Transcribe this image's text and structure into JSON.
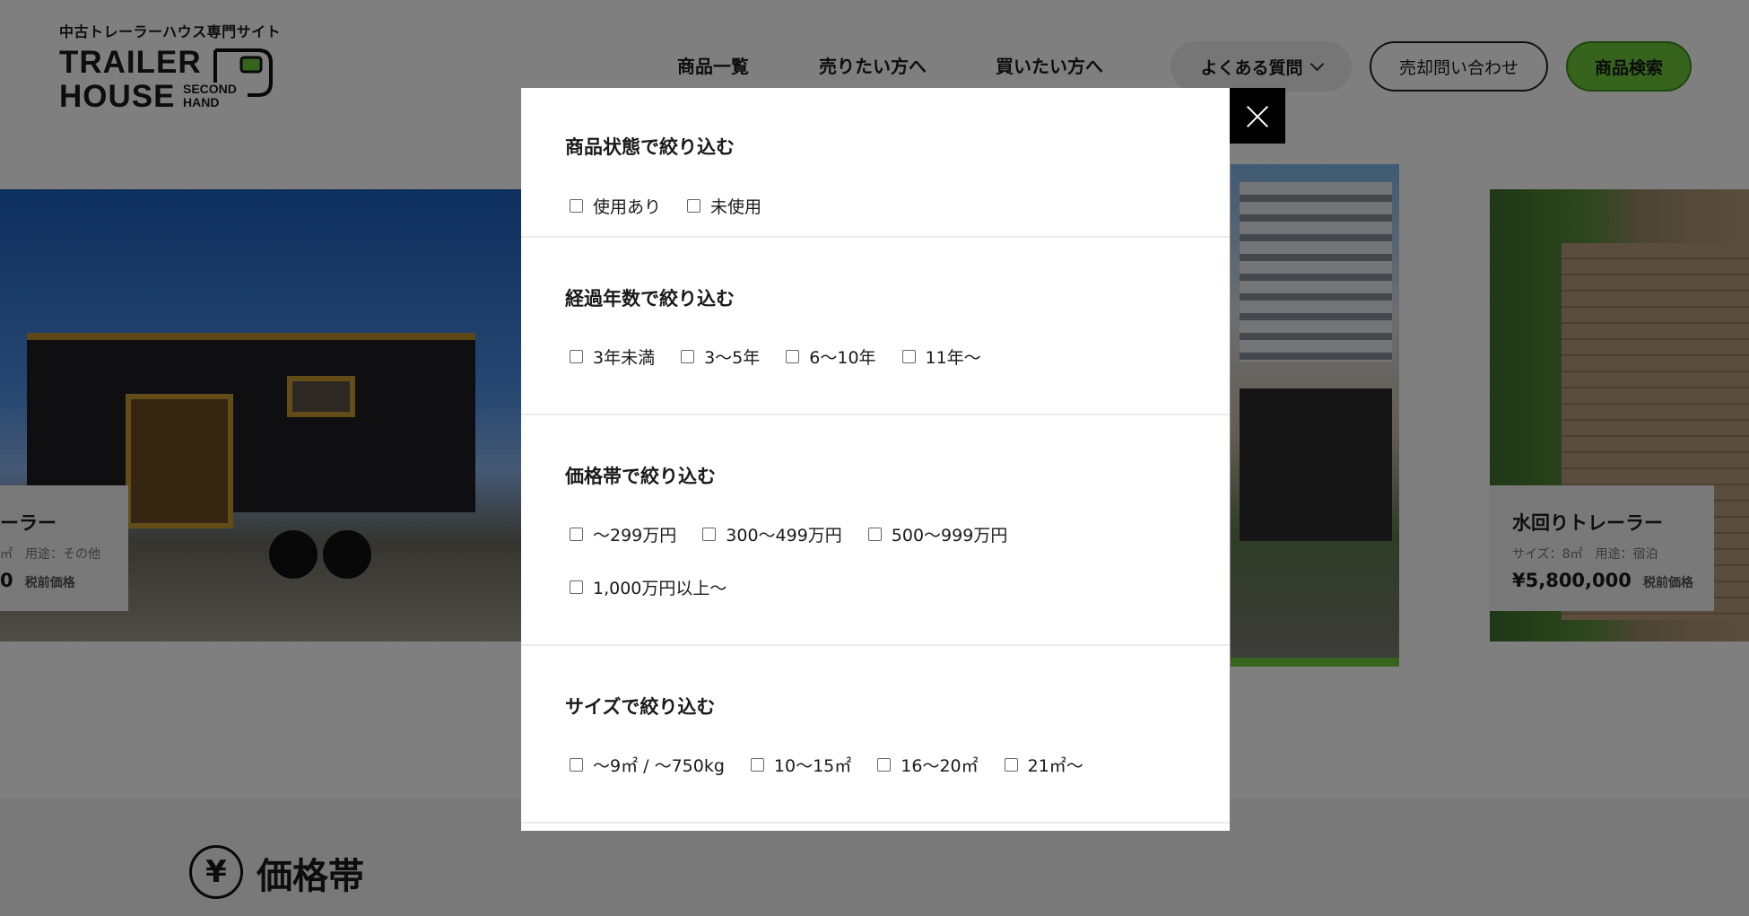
{
  "header": {
    "logo_tagline": "中古トレーラーハウス専門サイト",
    "logo_line1": "TRAILER",
    "logo_line2": "HOUSE",
    "logo_second": "SECOND",
    "logo_hand": "HAND",
    "nav": [
      "商品一覧",
      "売りたい方へ",
      "買いたい方へ"
    ],
    "faq_label": "よくある質問",
    "contact_label": "売却問い合わせ",
    "search_label": "商品検索",
    "accent_color": "#6cc83b"
  },
  "slider": {
    "left_card": {
      "name": "ーラー",
      "meta": "㎡　用途：その他",
      "price": "0",
      "tax_label": "税前価格"
    },
    "right_card": {
      "name": "水回りトレーラー",
      "meta": "サイズ：8㎡　用途：宿泊",
      "price": "¥5,800,000",
      "tax_label": "税前価格"
    }
  },
  "lower": {
    "icon_symbol": "¥",
    "heading": "価格帯"
  },
  "modal": {
    "sections": [
      {
        "title": "商品状態で絞り込む",
        "options": [
          "使用あり",
          "未使用"
        ]
      },
      {
        "title": "経過年数で絞り込む",
        "options": [
          "3年未満",
          "3〜5年",
          "6〜10年",
          "11年〜"
        ]
      },
      {
        "title": "価格帯で絞り込む",
        "options": [
          "〜299万円",
          "300〜499万円",
          "500〜999万円",
          "1,000万円以上〜"
        ]
      },
      {
        "title": "サイズで絞り込む",
        "options": [
          "〜9㎡ / 〜750kg",
          "10〜15㎡",
          "16〜20㎡",
          "21㎡〜"
        ]
      }
    ]
  }
}
